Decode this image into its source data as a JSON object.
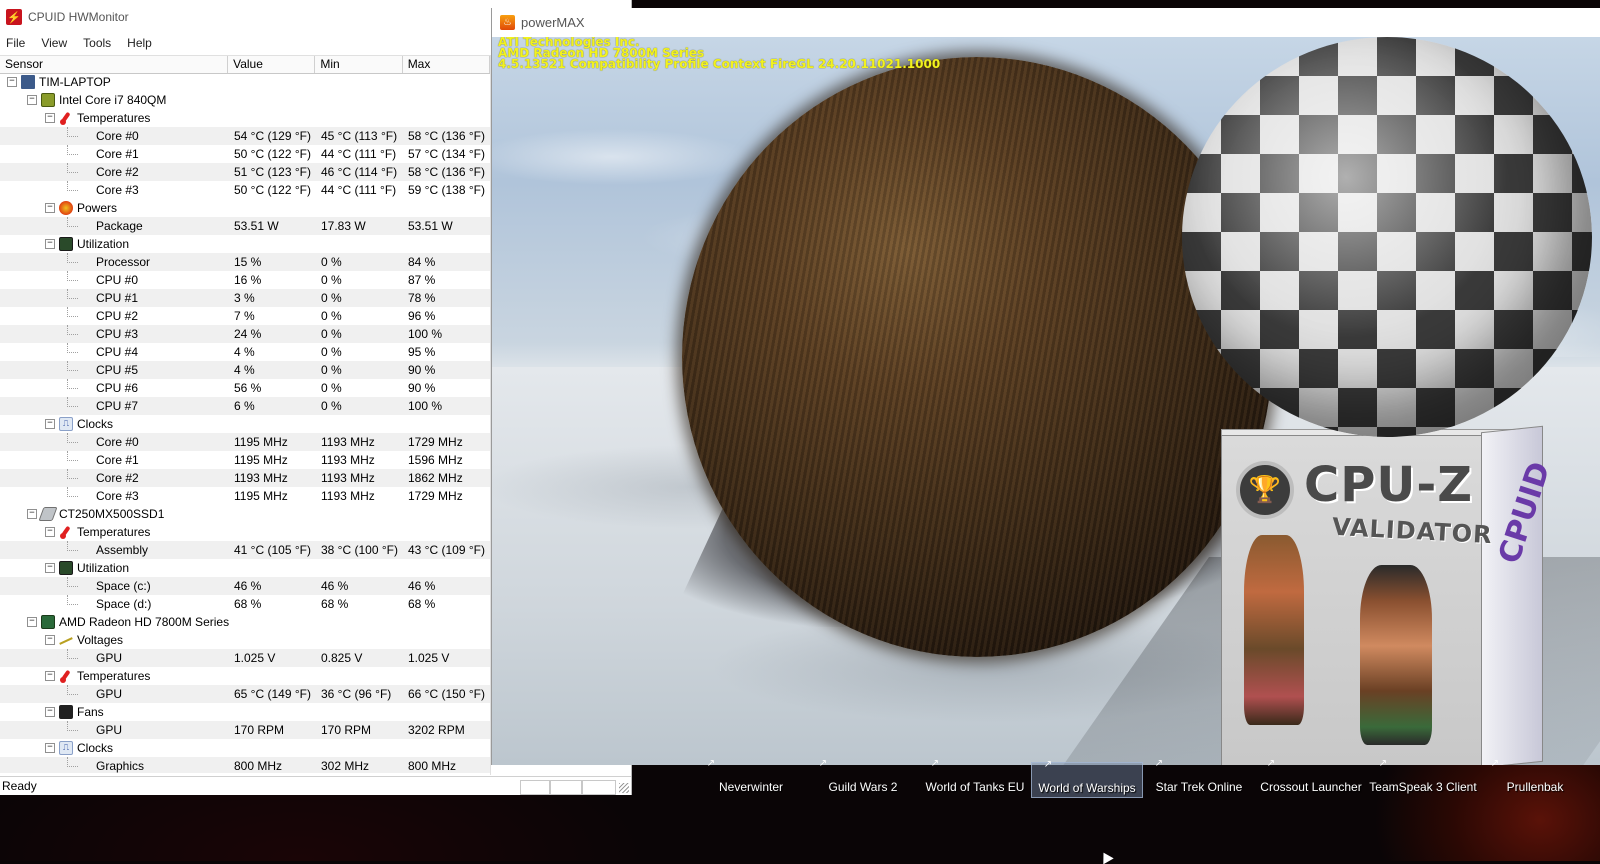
{
  "hwmonitor": {
    "title": "CPUID HWMonitor",
    "menu": [
      "File",
      "View",
      "Tools",
      "Help"
    ],
    "columns": [
      "Sensor",
      "Value",
      "Min",
      "Max"
    ],
    "status": "Ready",
    "rows": [
      {
        "level": 0,
        "type": "node",
        "icon": "laptop-icon",
        "label": "TIM-LAPTOP"
      },
      {
        "level": 1,
        "type": "node",
        "icon": "cpu-chip-icon",
        "label": "Intel Core i7 840QM"
      },
      {
        "level": 2,
        "type": "node",
        "icon": "thermometer-icon",
        "label": "Temperatures"
      },
      {
        "level": 3,
        "type": "leaf",
        "label": "Core #0",
        "value": "54 °C  (129 °F)",
        "min": "45 °C  (113 °F)",
        "max": "58 °C  (136 °F)"
      },
      {
        "level": 3,
        "type": "leaf",
        "label": "Core #1",
        "value": "50 °C  (122 °F)",
        "min": "44 °C  (111 °F)",
        "max": "57 °C  (134 °F)"
      },
      {
        "level": 3,
        "type": "leaf",
        "label": "Core #2",
        "value": "51 °C  (123 °F)",
        "min": "46 °C  (114 °F)",
        "max": "58 °C  (136 °F)"
      },
      {
        "level": 3,
        "type": "leaf",
        "label": "Core #3",
        "value": "50 °C  (122 °F)",
        "min": "44 °C  (111 °F)",
        "max": "59 °C  (138 °F)"
      },
      {
        "level": 2,
        "type": "node",
        "icon": "power-icon",
        "label": "Powers"
      },
      {
        "level": 3,
        "type": "leaf",
        "label": "Package",
        "value": "53.51 W",
        "min": "17.83 W",
        "max": "53.51 W"
      },
      {
        "level": 2,
        "type": "node",
        "icon": "utilization-icon",
        "label": "Utilization"
      },
      {
        "level": 3,
        "type": "leaf",
        "label": "Processor",
        "value": "15 %",
        "min": "0 %",
        "max": "84 %"
      },
      {
        "level": 3,
        "type": "leaf",
        "label": "CPU #0",
        "value": "16 %",
        "min": "0 %",
        "max": "87 %"
      },
      {
        "level": 3,
        "type": "leaf",
        "label": "CPU #1",
        "value": "3 %",
        "min": "0 %",
        "max": "78 %"
      },
      {
        "level": 3,
        "type": "leaf",
        "label": "CPU #2",
        "value": "7 %",
        "min": "0 %",
        "max": "96 %"
      },
      {
        "level": 3,
        "type": "leaf",
        "label": "CPU #3",
        "value": "24 %",
        "min": "0 %",
        "max": "100 %"
      },
      {
        "level": 3,
        "type": "leaf",
        "label": "CPU #4",
        "value": "4 %",
        "min": "0 %",
        "max": "95 %"
      },
      {
        "level": 3,
        "type": "leaf",
        "label": "CPU #5",
        "value": "4 %",
        "min": "0 %",
        "max": "90 %"
      },
      {
        "level": 3,
        "type": "leaf",
        "label": "CPU #6",
        "value": "56 %",
        "min": "0 %",
        "max": "90 %"
      },
      {
        "level": 3,
        "type": "leaf",
        "label": "CPU #7",
        "value": "6 %",
        "min": "0 %",
        "max": "100 %"
      },
      {
        "level": 2,
        "type": "node",
        "icon": "clock-icon",
        "label": "Clocks"
      },
      {
        "level": 3,
        "type": "leaf",
        "label": "Core #0",
        "value": "1195 MHz",
        "min": "1193 MHz",
        "max": "1729 MHz"
      },
      {
        "level": 3,
        "type": "leaf",
        "label": "Core #1",
        "value": "1195 MHz",
        "min": "1193 MHz",
        "max": "1596 MHz"
      },
      {
        "level": 3,
        "type": "leaf",
        "label": "Core #2",
        "value": "1193 MHz",
        "min": "1193 MHz",
        "max": "1862 MHz"
      },
      {
        "level": 3,
        "type": "leaf",
        "label": "Core #3",
        "value": "1195 MHz",
        "min": "1193 MHz",
        "max": "1729 MHz"
      },
      {
        "level": 1,
        "type": "node",
        "icon": "ssd-icon",
        "label": "CT250MX500SSD1"
      },
      {
        "level": 2,
        "type": "node",
        "icon": "thermometer-icon",
        "label": "Temperatures"
      },
      {
        "level": 3,
        "type": "leaf",
        "label": "Assembly",
        "value": "41 °C  (105 °F)",
        "min": "38 °C  (100 °F)",
        "max": "43 °C  (109 °F)"
      },
      {
        "level": 2,
        "type": "node",
        "icon": "utilization-icon",
        "label": "Utilization"
      },
      {
        "level": 3,
        "type": "leaf",
        "label": "Space (c:)",
        "value": "46 %",
        "min": "46 %",
        "max": "46 %"
      },
      {
        "level": 3,
        "type": "leaf",
        "label": "Space (d:)",
        "value": "68 %",
        "min": "68 %",
        "max": "68 %"
      },
      {
        "level": 1,
        "type": "node",
        "icon": "gpu-icon",
        "label": "AMD Radeon HD 7800M Series"
      },
      {
        "level": 2,
        "type": "node",
        "icon": "voltage-icon",
        "label": "Voltages"
      },
      {
        "level": 3,
        "type": "leaf",
        "label": "GPU",
        "value": "1.025 V",
        "min": "0.825 V",
        "max": "1.025 V"
      },
      {
        "level": 2,
        "type": "node",
        "icon": "thermometer-icon",
        "label": "Temperatures"
      },
      {
        "level": 3,
        "type": "leaf",
        "label": "GPU",
        "value": "65 °C  (149 °F)",
        "min": "36 °C  (96 °F)",
        "max": "66 °C  (150 °F)"
      },
      {
        "level": 2,
        "type": "node",
        "icon": "fan-icon",
        "label": "Fans"
      },
      {
        "level": 3,
        "type": "leaf",
        "label": "GPU",
        "value": "170 RPM",
        "min": "170 RPM",
        "max": "3202 RPM"
      },
      {
        "level": 2,
        "type": "node",
        "icon": "clock-icon",
        "label": "Clocks"
      },
      {
        "level": 3,
        "type": "leaf",
        "label": "Graphics",
        "value": "800 MHz",
        "min": "302 MHz",
        "max": "800 MHz"
      }
    ]
  },
  "powermax": {
    "title": "powerMAX",
    "gl_info": [
      "ATI Technologies Inc.",
      "AMD Radeon HD 7800M Series",
      "4.5.13521 Compatibility Profile Context FireGL 24.20.11021.1000"
    ],
    "cpuz_logo": "CPU-Z",
    "cpuz_sub": "VALIDATOR",
    "cpuid_side": "CPUID"
  },
  "desktop_icons": [
    {
      "label": "Neverwinter",
      "selected": false
    },
    {
      "label": "Guild Wars 2",
      "selected": false
    },
    {
      "label": "World of Tanks EU",
      "selected": false
    },
    {
      "label": "World of Warships",
      "selected": true
    },
    {
      "label": "Star Trek Online",
      "selected": false
    },
    {
      "label": "Crossout Launcher",
      "selected": false
    },
    {
      "label": "TeamSpeak 3 Client",
      "selected": false
    },
    {
      "label": "Prullenbak",
      "selected": false
    }
  ]
}
